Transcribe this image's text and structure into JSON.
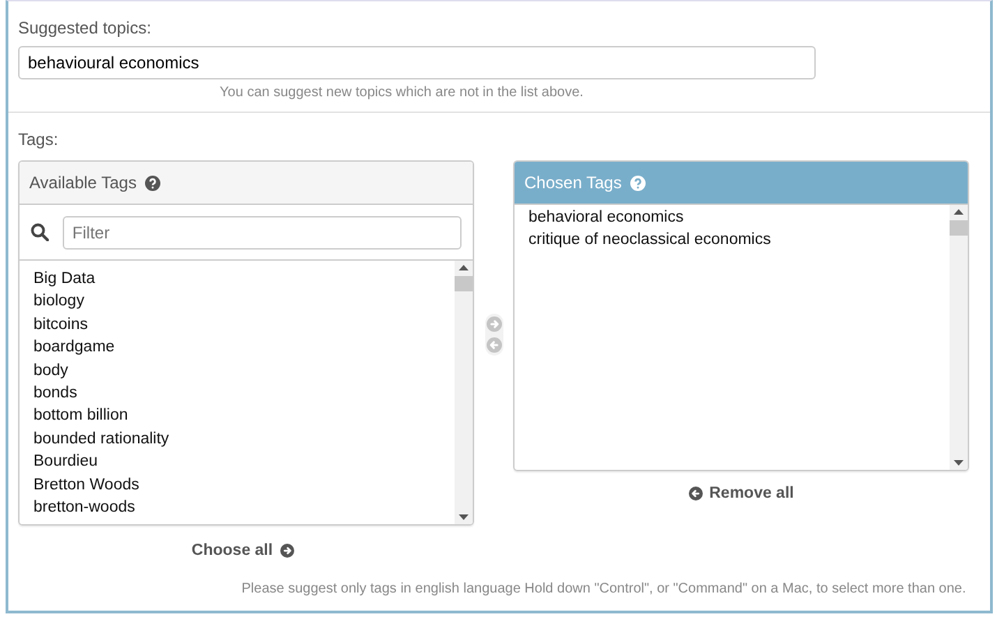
{
  "suggested_topics": {
    "label": "Suggested topics:",
    "value": "behavioural economics",
    "help": "You can suggest new topics which are not in the list above."
  },
  "tags": {
    "label": "Tags:",
    "available": {
      "title": "Available Tags",
      "filter_placeholder": "Filter",
      "items": [
        "Big Data",
        "biology",
        "bitcoins",
        "boardgame",
        "body",
        "bonds",
        "bottom billion",
        "bounded rationality",
        "Bourdieu",
        "Bretton Woods",
        "bretton-woods"
      ],
      "choose_all": "Choose all"
    },
    "chosen": {
      "title": "Chosen Tags",
      "items": [
        "behavioral economics",
        "critique of neoclassical economics"
      ],
      "remove_all": "Remove all"
    },
    "help": "Please suggest only tags in english language Hold down \"Control\", or \"Command\" on a Mac, to select more than one."
  }
}
